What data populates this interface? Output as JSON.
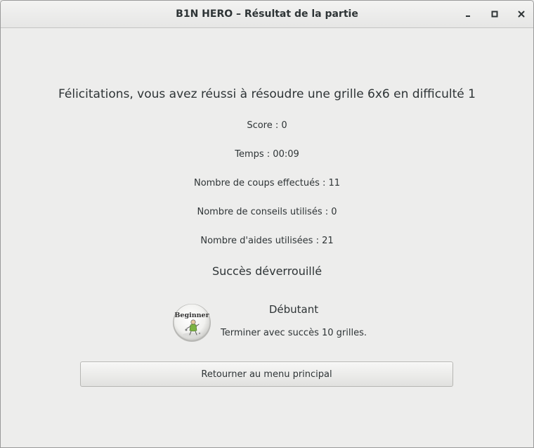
{
  "window": {
    "title": "B1N HERO – Résultat de la partie",
    "controls": [
      "minimize-icon",
      "maximize-icon",
      "close-icon"
    ]
  },
  "result": {
    "headline": "Félicitations, vous avez réussi à résoudre une grille 6x6 en difficulté 1",
    "score": "Score : 0",
    "time": "Temps : 00:09",
    "moves": "Nombre de coups effectués : 11",
    "tips": "Nombre de conseils utilisés : 0",
    "helps": "Nombre d'aides utilisées : 21"
  },
  "achievement": {
    "heading": "Succès déverrouillé",
    "badge_text": "Beginner",
    "badge_icon": "beginner-badge-icon",
    "name": "Débutant",
    "description": "Terminer avec succès 10 grilles."
  },
  "actions": {
    "back_label": "Retourner au menu principal"
  },
  "colors": {
    "background": "#ededec",
    "text": "#2e3436",
    "badge_green": "#7cb342"
  }
}
